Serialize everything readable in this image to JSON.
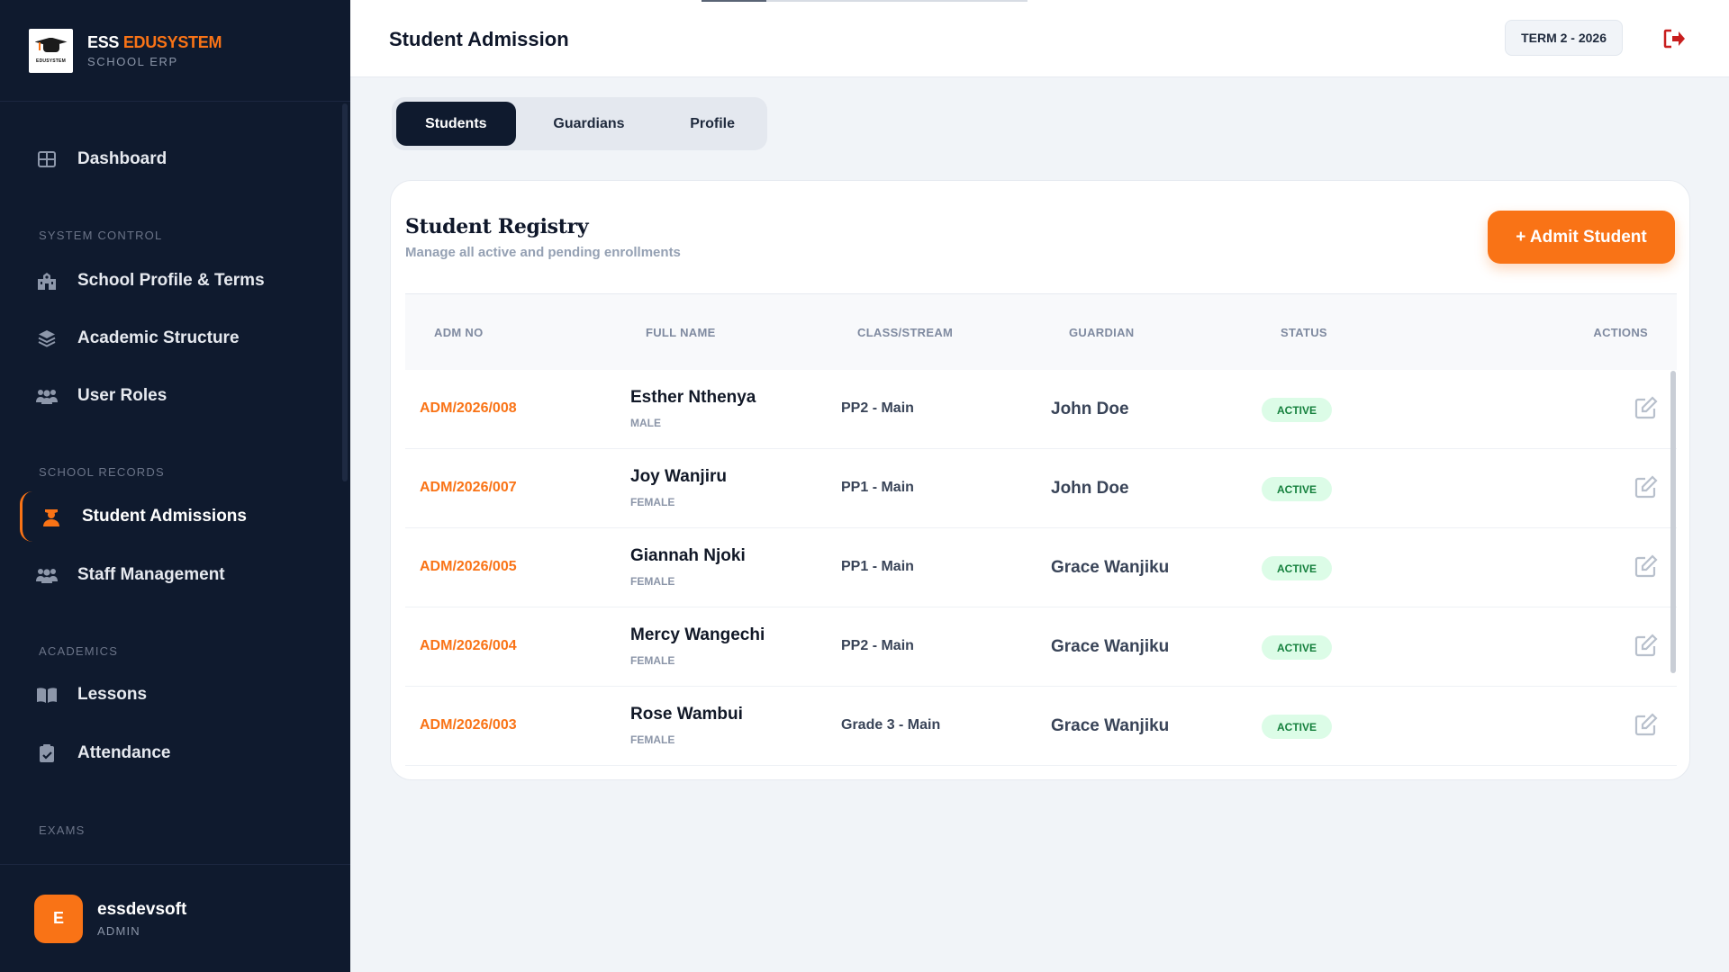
{
  "brand": {
    "name_white": "ESS",
    "name_orange": "EDUSYSTEM",
    "subtitle": "SCHOOL ERP",
    "logo_text": "EDUSYSTEM",
    "logo_cap_text": "ESS"
  },
  "sidebar": {
    "items": [
      {
        "label": "Dashboard",
        "icon": "grid-icon"
      },
      {
        "label": "School Profile & Terms",
        "icon": "school-icon"
      },
      {
        "label": "Academic Structure",
        "icon": "layers-icon"
      },
      {
        "label": "User Roles",
        "icon": "users-icon"
      },
      {
        "label": "Student Admissions",
        "icon": "student-icon"
      },
      {
        "label": "Staff Management",
        "icon": "users-icon"
      },
      {
        "label": "Lessons",
        "icon": "book-icon"
      },
      {
        "label": "Attendance",
        "icon": "clipboard-icon"
      }
    ],
    "sections": [
      "SYSTEM CONTROL",
      "SCHOOL RECORDS",
      "ACADEMICS",
      "EXAMS"
    ]
  },
  "user": {
    "initial": "E",
    "name": "essdevsoft",
    "role": "ADMIN"
  },
  "header": {
    "title": "Student Admission",
    "term": "TERM 2 - 2026"
  },
  "tabs": [
    "Students",
    "Guardians",
    "Profile"
  ],
  "registry": {
    "title": "Student Registry",
    "subtitle": "Manage all active and pending enrollments",
    "admit_button": "+ Admit Student",
    "columns": [
      "ADM NO",
      "FULL NAME",
      "CLASS/STREAM",
      "GUARDIAN",
      "STATUS",
      "ACTIONS"
    ],
    "rows": [
      {
        "adm": "ADM/2026/008",
        "name": "Esther Nthenya",
        "gender": "MALE",
        "class": "PP2 - Main",
        "guardian": "John Doe",
        "status": "ACTIVE"
      },
      {
        "adm": "ADM/2026/007",
        "name": "Joy Wanjiru",
        "gender": "FEMALE",
        "class": "PP1 - Main",
        "guardian": "John Doe",
        "status": "ACTIVE"
      },
      {
        "adm": "ADM/2026/005",
        "name": "Giannah Njoki",
        "gender": "FEMALE",
        "class": "PP1 - Main",
        "guardian": "Grace Wanjiku",
        "status": "ACTIVE"
      },
      {
        "adm": "ADM/2026/004",
        "name": "Mercy Wangechi",
        "gender": "FEMALE",
        "class": "PP2 - Main",
        "guardian": "Grace Wanjiku",
        "status": "ACTIVE"
      },
      {
        "adm": "ADM/2026/003",
        "name": "Rose Wambui",
        "gender": "FEMALE",
        "class": "Grade 3 - Main",
        "guardian": "Grace Wanjiku",
        "status": "ACTIVE"
      }
    ]
  },
  "colors": {
    "accent": "#f97316",
    "sidebar_bg": "#0f1a2e",
    "active_status_bg": "#dcfce7",
    "active_status_text": "#15803d",
    "logout": "#c81e1e"
  }
}
